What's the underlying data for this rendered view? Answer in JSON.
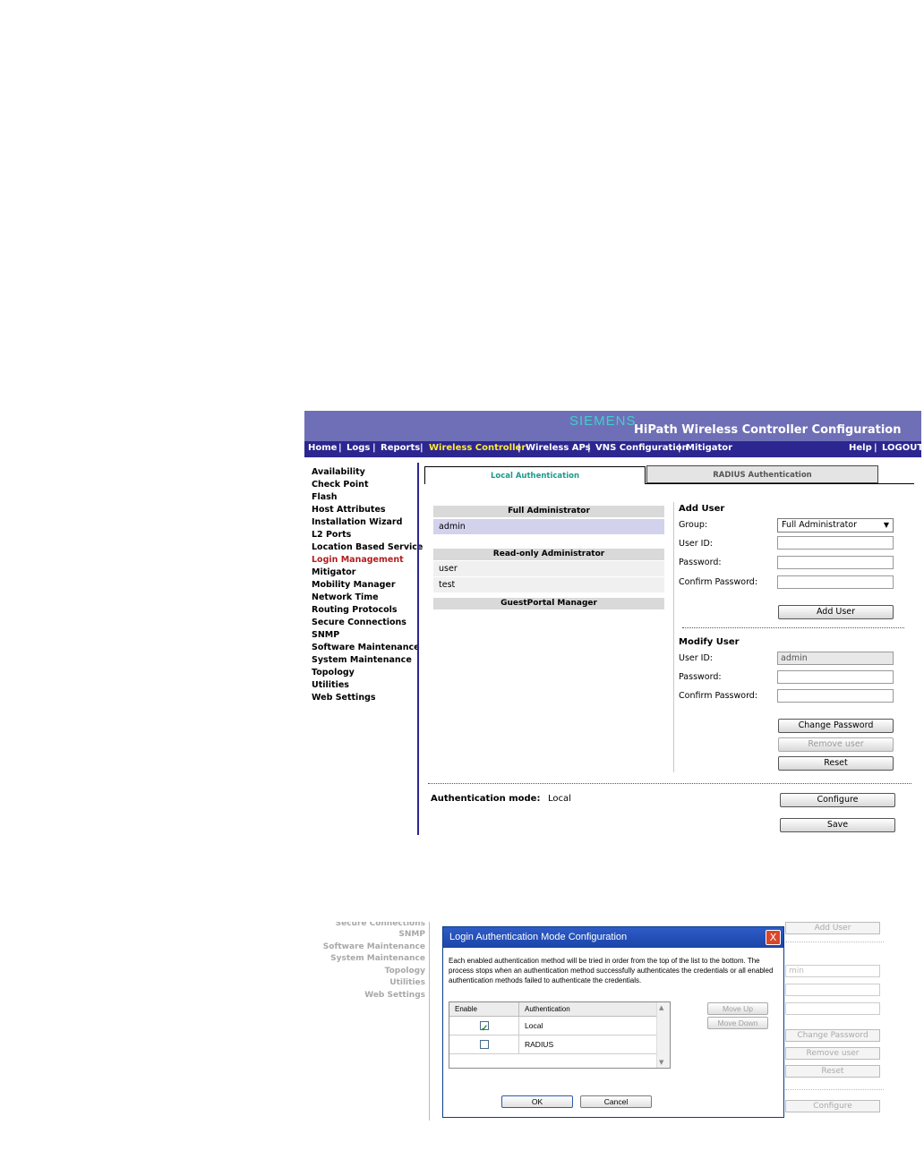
{
  "top": {
    "brand": "SIEMENS",
    "app_title": "HiPath Wireless Controller Configuration",
    "nav": [
      "Home",
      "Logs",
      "Reports",
      "Wireless Controller",
      "Wireless APs",
      "VNS Configuration",
      "Mitigator"
    ],
    "nav_active": "Wireless Controller",
    "nav_right": [
      "Help",
      "LOGOUT"
    ],
    "sidebar": [
      "Availability",
      "Check Point",
      "Flash",
      "Host Attributes",
      "Installation Wizard",
      "L2 Ports",
      "Location Based Service",
      "Login Management",
      "Mitigator",
      "Mobility Manager",
      "Network Time",
      "Routing Protocols",
      "Secure Connections",
      "SNMP",
      "Software Maintenance",
      "System Maintenance",
      "Topology",
      "Utilities",
      "Web Settings"
    ],
    "sidebar_active": "Login Management",
    "tabs": [
      "Local Authentication",
      "RADIUS Authentication"
    ],
    "groups": [
      {
        "title": "Full Administrator",
        "users": [
          "admin"
        ]
      },
      {
        "title": "Read-only Administrator",
        "users": [
          "user",
          "test"
        ]
      },
      {
        "title": "GuestPortal Manager",
        "users": []
      }
    ],
    "add_user": {
      "heading": "Add User",
      "group_label": "Group:",
      "group_value": "Full Administrator",
      "userid_label": "User ID:",
      "password_label": "Password:",
      "confirm_label": "Confirm Password:",
      "button": "Add User"
    },
    "modify_user": {
      "heading": "Modify User",
      "userid_label": "User ID:",
      "userid_value": "admin",
      "password_label": "Password:",
      "confirm_label": "Confirm Password:",
      "change_button": "Change Password",
      "remove_button": "Remove user",
      "reset_button": "Reset"
    },
    "auth_mode_label": "Authentication mode:",
    "auth_mode_value": "Local",
    "configure_button": "Configure",
    "save_button": "Save"
  },
  "bottom": {
    "bg_sidebar": [
      "Secure Connections",
      "SNMP",
      "Software Maintenance",
      "System Maintenance",
      "Topology",
      "Utilities",
      "Web Settings"
    ],
    "bg_buttons": {
      "add_user": "Add User",
      "change_password": "Change Password",
      "remove_user": "Remove user",
      "reset": "Reset",
      "configure": "Configure"
    },
    "bg_field_value": "min",
    "dialog": {
      "title": "Login Authentication Mode Configuration",
      "close_label": "X",
      "description": "Each enabled authentication method will be tried in order from the top of the list to the bottom. The process stops when an authentication method successfully authenticates the credentials or all enabled authentication methods failed to authenticate the credentials.",
      "columns": [
        "Enable",
        "Authentication"
      ],
      "rows": [
        {
          "name": "Local",
          "enabled": true
        },
        {
          "name": "RADIUS",
          "enabled": false
        }
      ],
      "move_up": "Move Up",
      "move_down": "Move Down",
      "ok": "OK",
      "cancel": "Cancel"
    }
  }
}
